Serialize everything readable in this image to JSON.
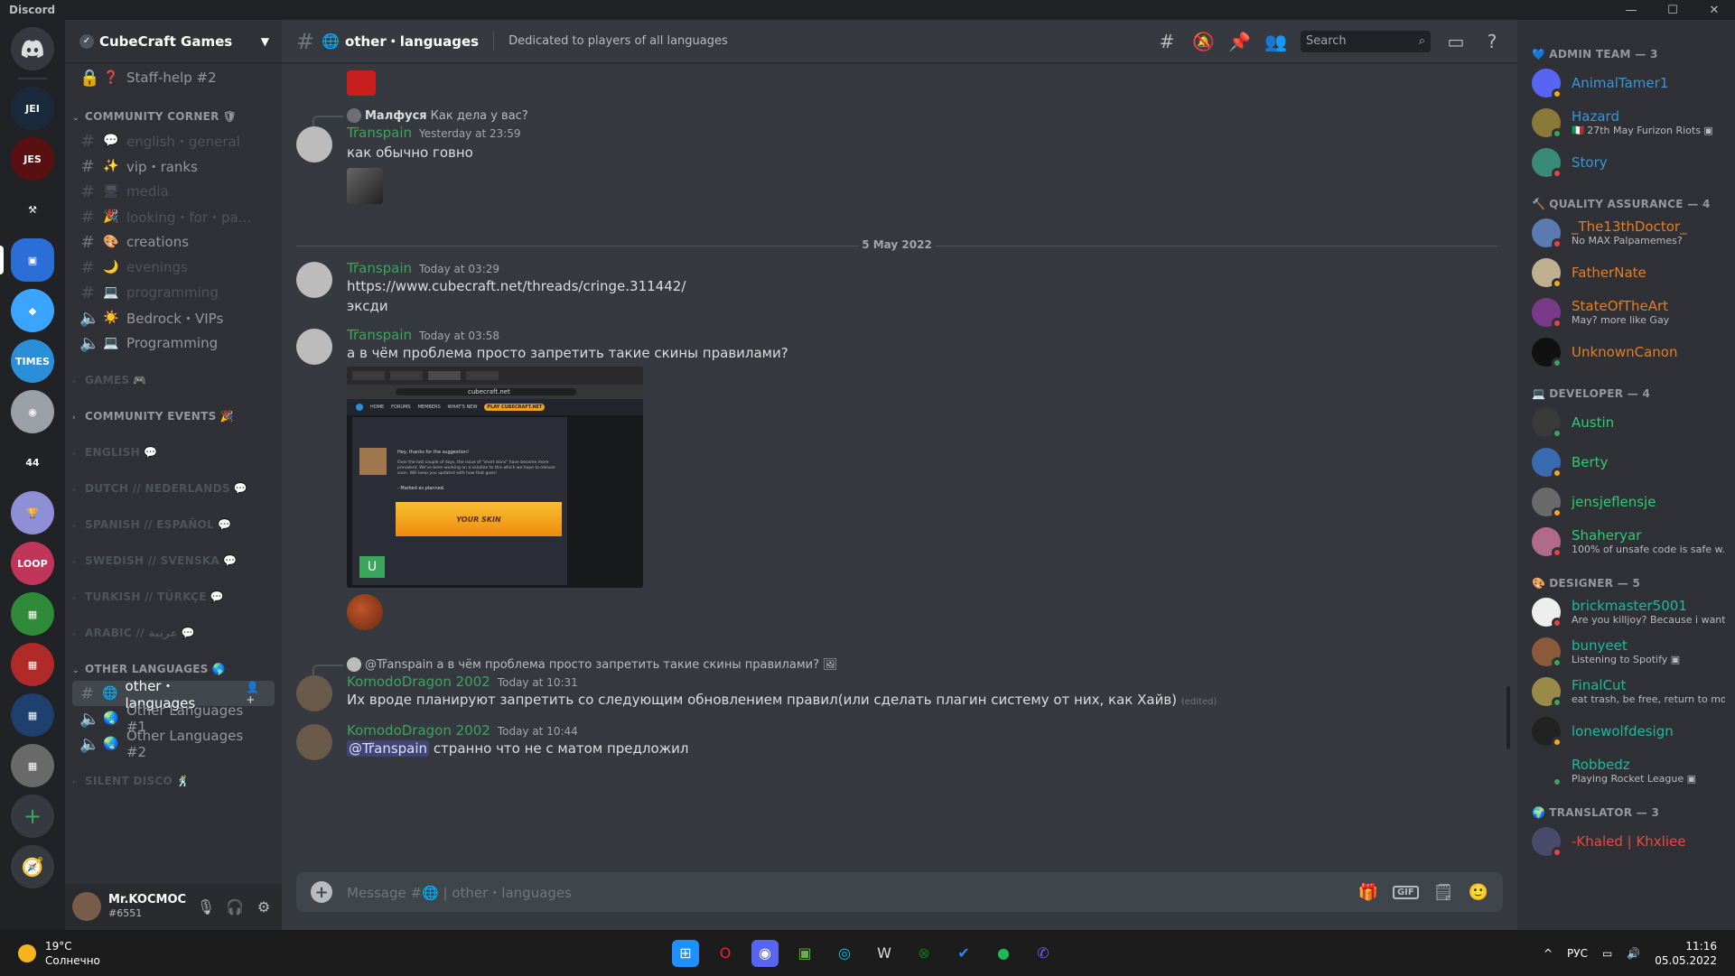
{
  "window": {
    "app_title": "Discord",
    "controls": [
      "—",
      "☐",
      "✕"
    ]
  },
  "server": {
    "name": "CubeCraft Games"
  },
  "guilds": [
    {
      "label": "",
      "color": "#36393f"
    },
    {
      "label": "JEI",
      "color": "#1b2a3a"
    },
    {
      "label": "JES",
      "color": "#5a1010"
    },
    {
      "label": "⚒",
      "color": "#202225"
    },
    {
      "label": "▣",
      "color": "#2b6fd6"
    },
    {
      "label": "◆",
      "color": "#3ba4ff"
    },
    {
      "label": "TIMES",
      "color": "#2a8fd8"
    },
    {
      "label": "◉",
      "color": "#9aa0a6"
    },
    {
      "label": "44",
      "color": "#202225"
    },
    {
      "label": "🏆",
      "color": "#8f8fd6"
    },
    {
      "label": "LOOP",
      "color": "#c0365a"
    },
    {
      "label": "▦",
      "color": "#2f8a3a"
    },
    {
      "label": "▦",
      "color": "#b02a2a"
    },
    {
      "label": "▦",
      "color": "#1f3f6f"
    },
    {
      "label": "▦",
      "color": "#6a6a6a"
    }
  ],
  "channels": {
    "staff_help": {
      "label": "Staff-help #2",
      "emoji": "❓"
    },
    "categories": [
      {
        "name": "COMMUNITY CORNER",
        "emoji": "🛡",
        "collapsed": false,
        "dim": false,
        "items": [
          {
            "type": "text",
            "emoji": "💬",
            "label": "english・general",
            "dim": true
          },
          {
            "type": "text",
            "emoji": "✨",
            "label": "vip・ranks",
            "dim": false
          },
          {
            "type": "text",
            "emoji": "🖥",
            "label": "media",
            "dim": true
          },
          {
            "type": "text",
            "emoji": "🎉",
            "label": "looking・for・pa...",
            "dim": true
          },
          {
            "type": "text",
            "emoji": "🎨",
            "label": "creations",
            "dim": false
          },
          {
            "type": "text",
            "emoji": "🌙",
            "label": "evenings",
            "dim": true
          },
          {
            "type": "text",
            "emoji": "💻",
            "label": "programming",
            "dim": true
          },
          {
            "type": "voice",
            "emoji": "☀️",
            "label": "Bedrock・VIPs",
            "dim": false
          },
          {
            "type": "voice",
            "emoji": "💻",
            "label": "Programming",
            "dim": false
          }
        ]
      },
      {
        "name": "GAMES",
        "emoji": "🎮",
        "collapsed": true,
        "dim": true,
        "items": []
      },
      {
        "name": "COMMUNITY EVENTS",
        "emoji": "🎉",
        "collapsed": true,
        "dim": false,
        "items": []
      },
      {
        "name": "ENGLISH",
        "emoji": "💬",
        "collapsed": true,
        "dim": true,
        "items": []
      },
      {
        "name": "DUTCH // NEDERLANDS",
        "emoji": "💬",
        "collapsed": true,
        "dim": true,
        "items": []
      },
      {
        "name": "SPANISH // ESPAÑOL",
        "emoji": "💬",
        "collapsed": true,
        "dim": true,
        "items": []
      },
      {
        "name": "SWEDISH // SVENSKA",
        "emoji": "💬",
        "collapsed": true,
        "dim": true,
        "items": []
      },
      {
        "name": "TURKISH // TÜRKÇE",
        "emoji": "💬",
        "collapsed": true,
        "dim": true,
        "items": []
      },
      {
        "name": "ARABIC // عربية",
        "emoji": "💬",
        "collapsed": true,
        "dim": true,
        "items": []
      },
      {
        "name": "OTHER LANGUAGES",
        "emoji": "🌎",
        "collapsed": false,
        "dim": false,
        "items": [
          {
            "type": "text",
            "emoji": "🌐",
            "label": "other・languages",
            "dim": false,
            "active": true
          },
          {
            "type": "voice",
            "emoji": "🌏",
            "label": "Other Languages #1",
            "dim": false
          },
          {
            "type": "voice",
            "emoji": "🌏",
            "label": "Other Languages #2",
            "dim": false
          }
        ]
      },
      {
        "name": "SILENT DISCO",
        "emoji": "🕺",
        "collapsed": true,
        "dim": true,
        "items": []
      }
    ]
  },
  "user": {
    "name": "Mr.KOCMOC",
    "tag": "#6551"
  },
  "header": {
    "channel": "other・languages",
    "topic": "Dedicated to players of all languages",
    "search_placeholder": "Search"
  },
  "messages": [
    {
      "reply_author": "Малфуся",
      "reply_text": "Как дела у вас?",
      "author": "Tr̃anspain",
      "author_color": "#3ba55c",
      "time": "Yesterday at 23:59",
      "text": "как обычно говно"
    },
    {
      "divider": "5 May 2022"
    },
    {
      "author": "Tr̃anspain",
      "author_color": "#3ba55c",
      "time": "Today at 03:29",
      "link": "https://www.cubecraft.net/threads/cringe.311442/",
      "text": "эксди"
    },
    {
      "author": "Tr̃anspain",
      "author_color": "#3ba55c",
      "time": "Today at 03:58",
      "text": "а в чём проблема просто запретить такие скины правилами?"
    },
    {
      "reply_author": "@Tr̃anspain",
      "reply_text": "а в чём проблема просто запретить такие скины правилами?",
      "author": "KomodoDragon 2002",
      "author_color": "#3ba55c",
      "time": "Today at 10:31",
      "text": "Их вроде планируют запретить со следующим обновлением правил(или сделать плагин систему от них, как Хайв)",
      "edited": "(edited)"
    },
    {
      "author": "KomodoDragon 2002",
      "author_color": "#3ba55c",
      "time": "Today at 10:44",
      "mention": "@Tr̃anspain",
      "text": "странно что не с матом предложил"
    }
  ],
  "screenshot_embed": {
    "url": "cubecraft.net",
    "nav": [
      "HOME",
      "FORUMS",
      "MEMBERS",
      "WHAT'S NEW"
    ],
    "cta": "PLAY CUBECRAFT.NET",
    "post_greeting": "Hey, thanks for the suggestion!",
    "post_body": "Over the last couple of days, the issue of \"short skins\" have become more prevalent. We've been working on a solution to this which we hope to release soon. Will keep you updated with how that goes!",
    "status": "- Marked as planned.",
    "banner_text": "YOUR SKIN",
    "avatar_letter": "U"
  },
  "composer": {
    "placeholder": "Message #🌐 | other・languages"
  },
  "members": [
    {
      "group": "ADMIN TEAM — 3",
      "emoji": "💙",
      "items": [
        {
          "name": "AnimalTamer1",
          "color": "#3498db",
          "status": "",
          "presence": "#faa61a",
          "av": "#5865f2"
        },
        {
          "name": "Hazard",
          "color": "#3498db",
          "status": "🇮🇹 27th May Furizon Riots ▣",
          "presence": "#3ba55c",
          "av": "#8a7a3a"
        },
        {
          "name": "Story",
          "color": "#3498db",
          "status": "",
          "presence": "#ed4245",
          "av": "#3a8a7a"
        }
      ]
    },
    {
      "group": "QUALITY ASSURANCE — 4",
      "emoji": "🔨",
      "items": [
        {
          "name": "_The13thDoctor_",
          "color": "#e67e22",
          "status": "No MAX Palpamemes?",
          "presence": "#ed4245",
          "av": "#5a7ab0"
        },
        {
          "name": "FatherNate",
          "color": "#e67e22",
          "status": "",
          "presence": "#faa61a",
          "av": "#c0b090"
        },
        {
          "name": "StateOfTheArt",
          "color": "#e67e22",
          "status": "May? more like Gay",
          "presence": "#ed4245",
          "av": "#7a3a8a"
        },
        {
          "name": "UnknownCanon",
          "color": "#e67e22",
          "status": "",
          "presence": "#3ba55c",
          "av": "#111111"
        }
      ]
    },
    {
      "group": "DEVELOPER — 4",
      "emoji": "💻",
      "items": [
        {
          "name": "Austin",
          "color": "#2ecc71",
          "status": "",
          "presence": "#3ba55c",
          "av": "#3a3a3a"
        },
        {
          "name": "Berty",
          "color": "#2ecc71",
          "status": "",
          "presence": "#faa61a",
          "av": "#3a6ab0"
        },
        {
          "name": "jensjeflensje",
          "color": "#2ecc71",
          "status": "",
          "presence": "#faa61a",
          "av": "#6a6a6a"
        },
        {
          "name": "Shaheryar",
          "color": "#2ecc71",
          "status": "100% of unsafe code is safe w...",
          "presence": "#ed4245",
          "av": "#b06a8a"
        }
      ]
    },
    {
      "group": "DESIGNER — 5",
      "emoji": "🎨",
      "items": [
        {
          "name": "brickmaster5001",
          "color": "#1abc9c",
          "status": "Are you killjoy? Because i want...",
          "presence": "#ed4245",
          "av": "#eeeeee"
        },
        {
          "name": "bunyeet",
          "color": "#1abc9c",
          "status": "Listening to Spotify ▣",
          "presence": "#3ba55c",
          "av": "#8a5a3a"
        },
        {
          "name": "FinalCut",
          "color": "#1abc9c",
          "status": "eat trash, be free, return to mo...",
          "presence": "#3ba55c",
          "av": "#9a8a4a"
        },
        {
          "name": "lonewolfdesign",
          "color": "#1abc9c",
          "status": "",
          "presence": "#faa61a",
          "av": "#222222"
        },
        {
          "name": "Robbedz",
          "color": "#1abc9c",
          "status": "Playing Rocket League ▣",
          "presence": "#3ba55c",
          "av": "#2f3136"
        }
      ]
    },
    {
      "group": "TRANSLATOR — 3",
      "emoji": "🌍",
      "items": [
        {
          "name": "-Khaled | Khxliee",
          "color": "#e74c3c",
          "status": "",
          "presence": "#ed4245",
          "av": "#4a4a6a"
        }
      ]
    }
  ],
  "taskbar": {
    "temp": "19°C",
    "weather": "Солнечно",
    "lang": "РУС",
    "time": "11:16",
    "date": "05.05.2022"
  }
}
